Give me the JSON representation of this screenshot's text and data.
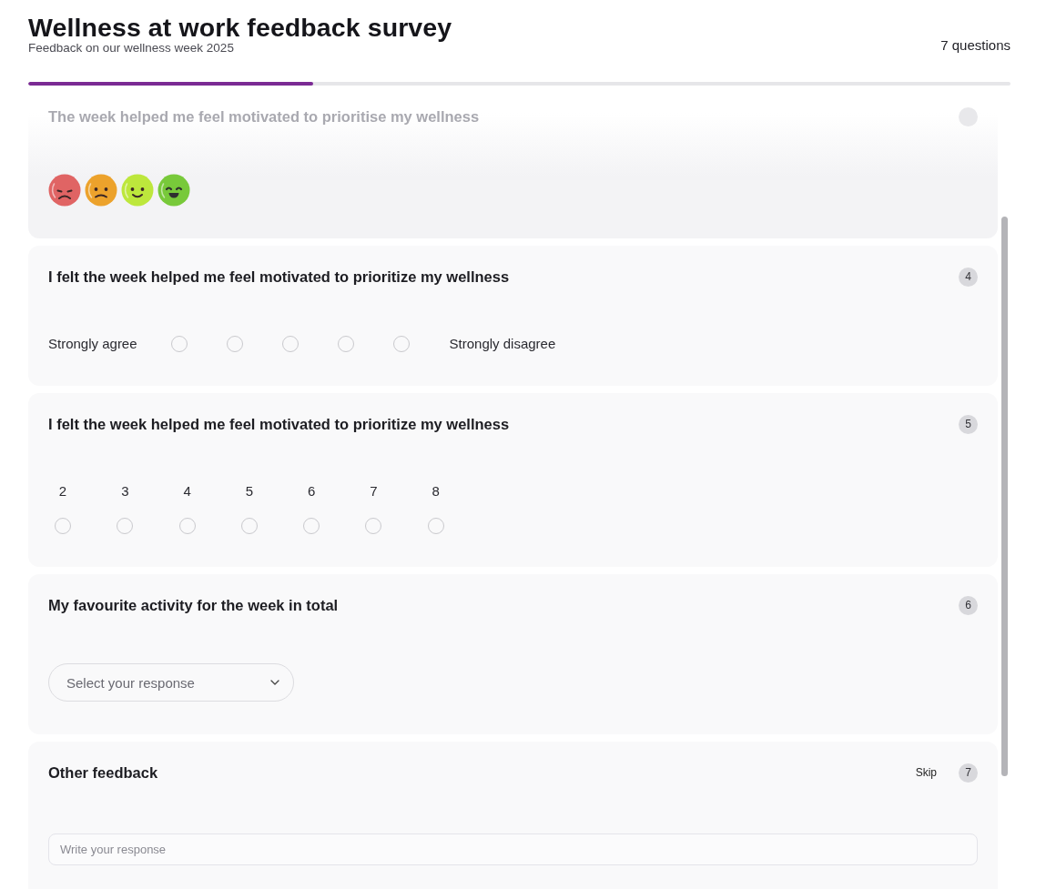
{
  "header": {
    "title": "Wellness at work feedback survey",
    "subtitle": "Feedback on our wellness week 2025",
    "question_count": "7 questions"
  },
  "progress": {
    "level": 0.29
  },
  "questions": [
    {
      "kind": "emoji",
      "faded": true,
      "title": "The week helped me feel motivated to prioritise my wellness",
      "options": [
        {
          "kind": "angry",
          "color": "#e06464",
          "selected": false
        },
        {
          "kind": "sad",
          "color": "#eca22c",
          "selected": false
        },
        {
          "kind": "smile",
          "color": "#bde73c",
          "selected": false
        },
        {
          "kind": "grin",
          "color": "#78c93a",
          "selected": false
        }
      ]
    },
    {
      "kind": "likert",
      "number": "4",
      "title": "I felt the week helped me feel motivated to prioritize my wellness",
      "low_label": "Strongly agree",
      "high_label": "Strongly disagree",
      "options": [
        {
          "selected": false
        },
        {
          "selected": false
        },
        {
          "selected": false
        },
        {
          "selected": false
        },
        {
          "selected": false
        }
      ]
    },
    {
      "kind": "scale",
      "number": "5",
      "title": "I felt the week helped me feel motivated to prioritize my wellness",
      "options": [
        {
          "label": "2",
          "selected": false
        },
        {
          "label": "3",
          "selected": false
        },
        {
          "label": "4",
          "selected": false
        },
        {
          "label": "5",
          "selected": false
        },
        {
          "label": "6",
          "selected": false
        },
        {
          "label": "7",
          "selected": false
        },
        {
          "label": "8",
          "selected": false
        }
      ]
    },
    {
      "kind": "select",
      "number": "6",
      "title": "My favourite activity for the week in total",
      "placeholder": "Select your response"
    },
    {
      "kind": "text",
      "number": "7",
      "title": "Other feedback",
      "skip": "Skip",
      "placeholder": "Write your response"
    }
  ]
}
